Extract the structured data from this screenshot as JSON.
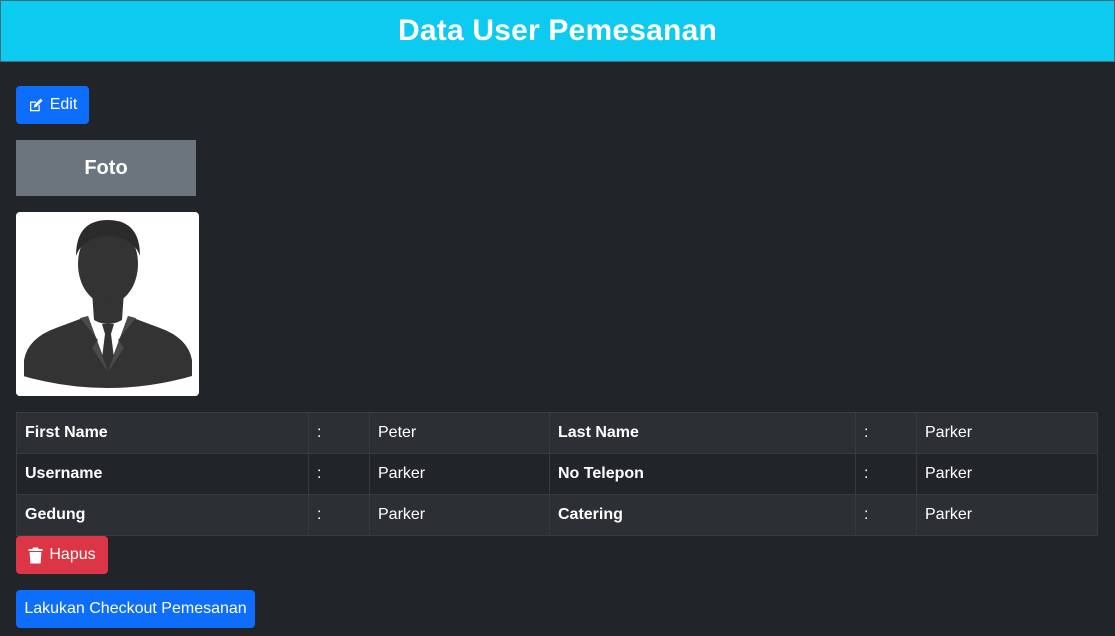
{
  "header": {
    "title": "Data User Pemesanan"
  },
  "edit_button": {
    "label": "Edit",
    "icon": "edit-icon"
  },
  "photo": {
    "label": "Foto",
    "image": "user-silhouette-icon"
  },
  "profile": {
    "rows": [
      [
        {
          "label": "First Name",
          "sep": ":",
          "value": "Peter"
        },
        {
          "label": "Last Name",
          "sep": ":",
          "value": "Parker"
        }
      ],
      [
        {
          "label": "Username",
          "sep": ":",
          "value": "Parker"
        },
        {
          "label": "No Telepon",
          "sep": ":",
          "value": "Parker"
        }
      ],
      [
        {
          "label": "Gedung",
          "sep": ":",
          "value": "Parker"
        },
        {
          "label": "Catering",
          "sep": ":",
          "value": "Parker"
        }
      ]
    ]
  },
  "delete_button": {
    "label": "Hapus",
    "icon": "trash-icon"
  },
  "checkout_button": {
    "label": "Lakukan Checkout Pemesanan"
  },
  "colors": {
    "header_bg": "#0dcaf0",
    "page_bg": "#212529",
    "primary": "#0d6efd",
    "danger": "#dc3545",
    "secondary": "#6c757d"
  }
}
